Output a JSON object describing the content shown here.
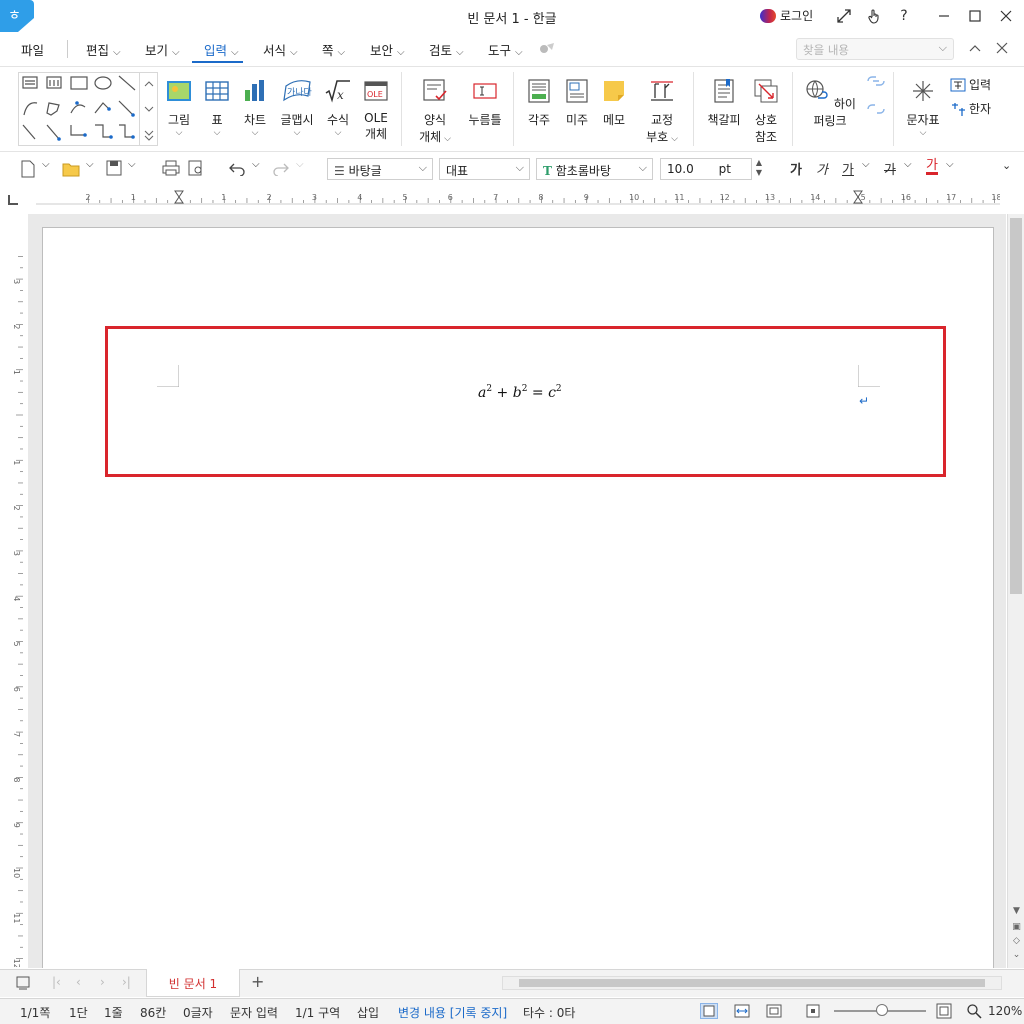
{
  "titlebar": {
    "title": "빈 문서 1 - 한글",
    "login_label": "로그인",
    "help_label": "?"
  },
  "menu": {
    "items": [
      "파일",
      "편집",
      "보기",
      "입력",
      "서식",
      "쪽",
      "보안",
      "검토",
      "도구"
    ],
    "active": "입력",
    "search_placeholder": "찾을 내용"
  },
  "ribbon": {
    "buttons": [
      {
        "label": "그림",
        "icon": "image-icon"
      },
      {
        "label": "표",
        "icon": "table-icon"
      },
      {
        "label": "차트",
        "icon": "chart-icon"
      },
      {
        "label": "글맵시",
        "icon": "wordart-icon"
      },
      {
        "label": "수식",
        "icon": "formula-icon"
      },
      {
        "label": "OLE",
        "label2": "개체",
        "icon": "ole-icon"
      },
      {
        "label": "양식",
        "label2": "개체",
        "icon": "form-object-icon"
      },
      {
        "label": "누름틀",
        "icon": "field-icon"
      },
      {
        "label": "각주",
        "icon": "footnote-icon"
      },
      {
        "label": "미주",
        "icon": "endnote-icon"
      },
      {
        "label": "메모",
        "icon": "memo-icon"
      },
      {
        "label": "교정",
        "label2": "부호",
        "icon": "proofread-icon"
      },
      {
        "label": "책갈피",
        "icon": "bookmark-icon"
      },
      {
        "label": "상호",
        "label2": "참조",
        "icon": "cross-reference-icon"
      },
      {
        "label": "하이퍼링크",
        "icon": "hyperlink-icon"
      },
      {
        "label": "문자표",
        "icon": "symbol-icon"
      },
      {
        "label": "입력",
        "icon": "kanji-input-icon"
      },
      {
        "label": "한자",
        "icon": "hanja-icon"
      },
      {
        "label": "OLE",
        "icon": "ole-badge"
      }
    ],
    "wordart_text": "가나다"
  },
  "format": {
    "style": "바탕글",
    "lang": "대표",
    "font": "함초롬바탕",
    "size": "10.0",
    "unit": "pt",
    "bold": "가",
    "italic": "가",
    "underline": "가",
    "strike": "가",
    "color": "가",
    "font_icon_glyph": "T"
  },
  "ruler": {
    "h_labels": [
      "2",
      "1",
      "1",
      "2",
      "3",
      "4",
      "5",
      "6",
      "7",
      "8",
      "9",
      "10",
      "11",
      "12",
      "13",
      "14",
      "15",
      "16",
      "17",
      "18"
    ],
    "v_labels": [
      "3",
      "2",
      "1",
      "1",
      "2",
      "3",
      "4",
      "5",
      "6",
      "7",
      "8",
      "9",
      "10",
      "11",
      "12"
    ]
  },
  "document": {
    "equation": {
      "a": "a",
      "b": "b",
      "c": "c",
      "exp": "2",
      "plus": "+",
      "eq": "="
    },
    "para_mark": "↵"
  },
  "tabs": {
    "doc_tab": "빈 문서 1",
    "add_label": "+"
  },
  "status": {
    "page": "1/1쪽",
    "column": "1단",
    "line": "1줄",
    "col": "86칸",
    "chars": "0글자",
    "mode": "문자 입력",
    "section": "1/1 구역",
    "insert": "삽입",
    "track": "변경 내용 [기록 중지]",
    "keystrokes": "타수 : 0타",
    "zoom": "120%",
    "zoom_level": 0.45
  },
  "colors": {
    "accent": "#1b6ac9",
    "highlight": "#d9252c",
    "tab_text": "#d23030"
  }
}
